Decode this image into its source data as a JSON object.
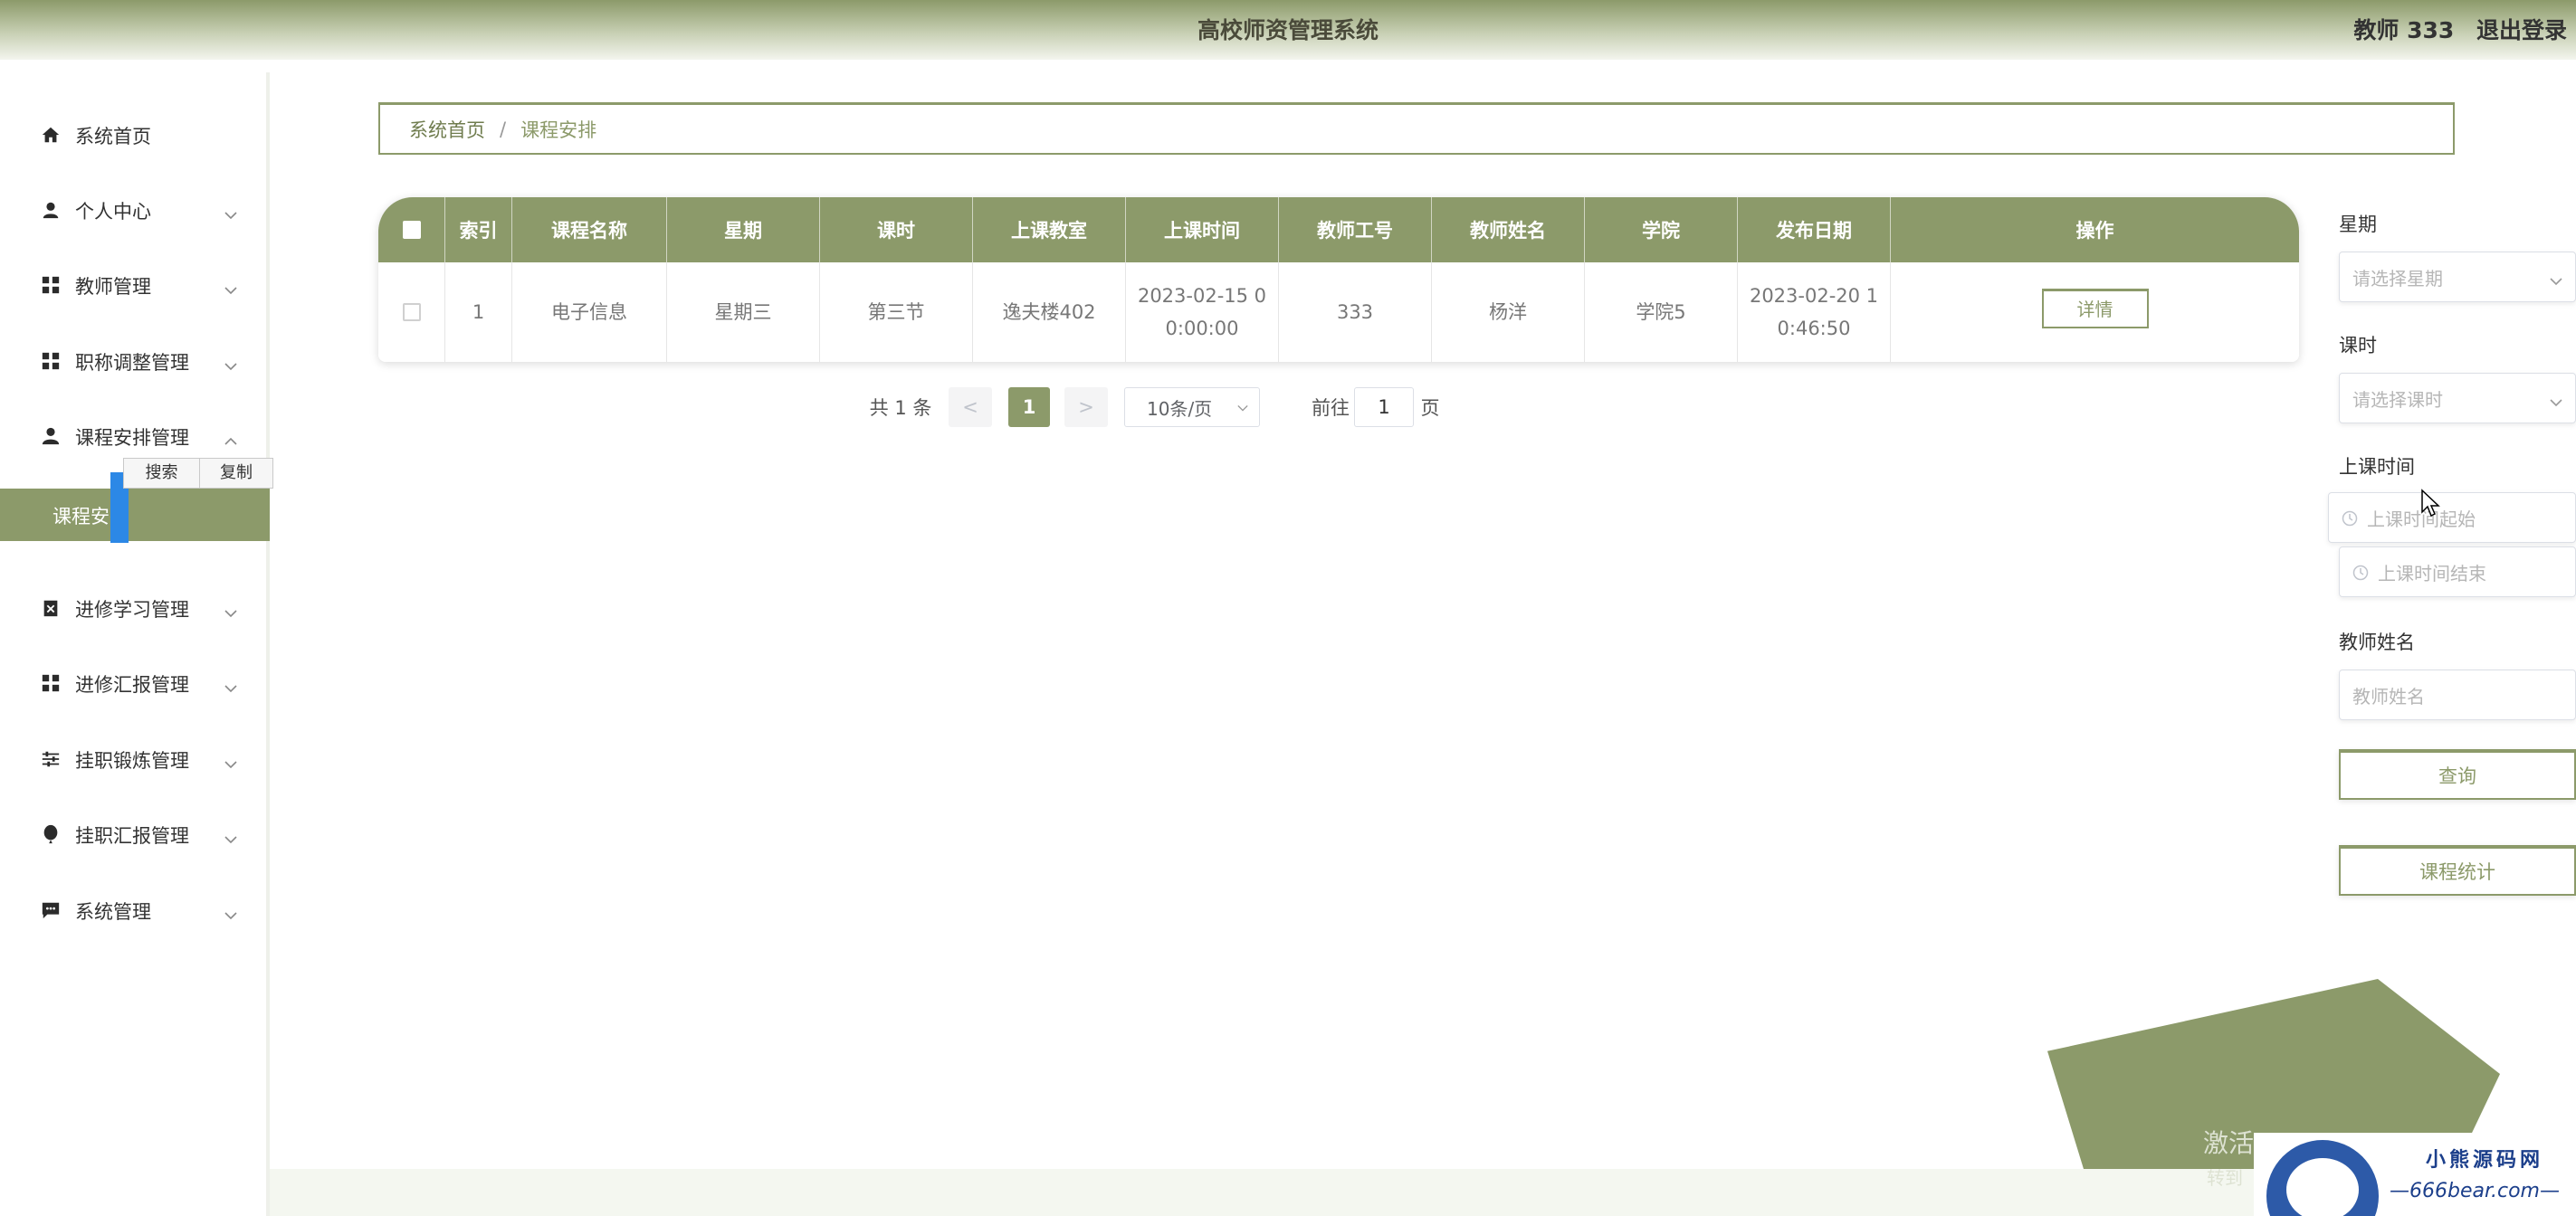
{
  "header": {
    "title": "高校师资管理系统",
    "user_label": "教师 333",
    "logout_label": "退出登录"
  },
  "sidebar": {
    "items": [
      {
        "label": "系统首页",
        "icon": "home-icon"
      },
      {
        "label": "个人中心",
        "icon": "user-icon"
      },
      {
        "label": "教师管理",
        "icon": "grid-icon"
      },
      {
        "label": "职称调整管理",
        "icon": "grid-icon"
      },
      {
        "label": "课程安排管理",
        "icon": "user-tie-icon"
      },
      {
        "label": "进修学习管理",
        "icon": "clipboard-icon"
      },
      {
        "label": "进修汇报管理",
        "icon": "grid-icon"
      },
      {
        "label": "挂职锻炼管理",
        "icon": "sliders-icon"
      },
      {
        "label": "挂职汇报管理",
        "icon": "balloon-icon"
      },
      {
        "label": "系统管理",
        "icon": "chat-icon"
      }
    ],
    "active_sub": "课程安排",
    "context_menu": [
      "搜索",
      "复制"
    ]
  },
  "breadcrumb": {
    "home": "系统首页",
    "separator": "/",
    "current": "课程安排"
  },
  "table": {
    "headers": [
      "索引",
      "课程名称",
      "星期",
      "课时",
      "上课教室",
      "上课时间",
      "教师工号",
      "教师姓名",
      "学院",
      "发布日期",
      "操作"
    ],
    "rows": [
      {
        "index": "1",
        "course": "电子信息",
        "weekday": "星期三",
        "period": "第三节",
        "room": "逸夫楼402",
        "time_line1": "2023-02-15 0",
        "time_line2": "0:00:00",
        "teacher_no": "333",
        "teacher_name": "杨洋",
        "college": "学院5",
        "date_line1": "2023-02-20 1",
        "date_line2": "0:46:50",
        "action": "详情"
      }
    ]
  },
  "pagination": {
    "total": "共 1 条",
    "prev": "<",
    "current": "1",
    "next": ">",
    "page_size": "10条/页",
    "goto_prefix": "前往",
    "goto_value": "1",
    "goto_suffix": "页"
  },
  "filters": {
    "weekday_label": "星期",
    "weekday_placeholder": "请选择星期",
    "period_label": "课时",
    "period_placeholder": "请选择课时",
    "time_label": "上课时间",
    "time_start_placeholder": "上课时间起始",
    "time_end_placeholder": "上课时间结束",
    "teacher_label": "教师姓名",
    "teacher_placeholder": "教师姓名",
    "search_button": "查询",
    "stats_button": "课程统计"
  },
  "overlay": {
    "activate_line1": "激活",
    "activate_line2": "转到",
    "watermark_line1": "小熊源码网",
    "watermark_line2": "—666bear.com—"
  },
  "colors": {
    "accent": "#8c9a6a",
    "watermark_blue": "#1c3f8b",
    "selection_blue": "#2c88e6"
  }
}
